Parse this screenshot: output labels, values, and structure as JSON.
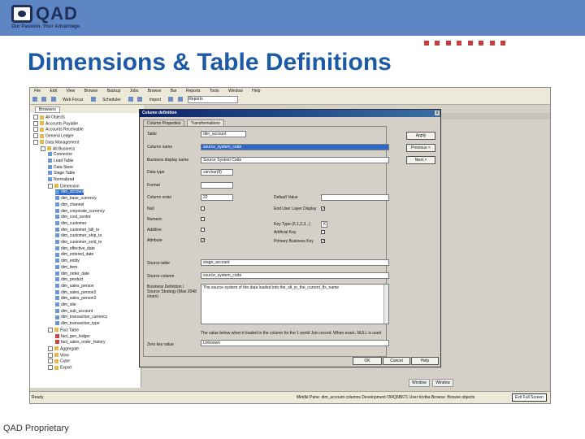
{
  "brand": {
    "name": "QAD",
    "tagline": "Our Passion. Your Advantage."
  },
  "slide_title": "Dimensions & Table Definitions",
  "footer": "QAD Proprietary",
  "app": {
    "menu": [
      "File",
      "Edit",
      "View",
      "Browse",
      "Backup",
      "Jobs",
      "Browse",
      "Bar",
      "Reports",
      "Tools",
      "Window",
      "Help"
    ],
    "toolbar": {
      "web_label": "Web Focus",
      "scheduler": "Scheduler",
      "import": "Import",
      "reports": "Reports"
    },
    "tab_label": "Browsers",
    "tree": [
      {
        "label": "All Objects",
        "indent": 0,
        "icon": "folder"
      },
      {
        "label": "Accounts Payable",
        "indent": 0,
        "icon": "folder"
      },
      {
        "label": "Accounts Receivable",
        "indent": 0,
        "icon": "folder"
      },
      {
        "label": "General Ledger",
        "indent": 0,
        "icon": "folder"
      },
      {
        "label": "Data Management",
        "indent": 0,
        "icon": "folder"
      },
      {
        "label": "All Business",
        "indent": 1,
        "icon": "folder"
      },
      {
        "label": "Connector",
        "indent": 2,
        "icon": "table"
      },
      {
        "label": "Load Table",
        "indent": 2,
        "icon": "table"
      },
      {
        "label": "Data Store",
        "indent": 2,
        "icon": "table"
      },
      {
        "label": "Stage Table",
        "indent": 2,
        "icon": "table"
      },
      {
        "label": "Normalized",
        "indent": 2,
        "icon": "table"
      },
      {
        "label": "Dimension",
        "indent": 2,
        "icon": "folder"
      },
      {
        "label": "dim_account",
        "indent": 3,
        "icon": "table",
        "selected": true
      },
      {
        "label": "dim_base_currency",
        "indent": 3,
        "icon": "table"
      },
      {
        "label": "dim_channel",
        "indent": 3,
        "icon": "table"
      },
      {
        "label": "dim_corporate_currency",
        "indent": 3,
        "icon": "table"
      },
      {
        "label": "dim_cost_centre",
        "indent": 3,
        "icon": "table"
      },
      {
        "label": "dim_customer",
        "indent": 3,
        "icon": "table"
      },
      {
        "label": "dim_customer_bill_to",
        "indent": 3,
        "icon": "table"
      },
      {
        "label": "dim_customer_ship_to",
        "indent": 3,
        "icon": "table"
      },
      {
        "label": "dim_customer_sold_to",
        "indent": 3,
        "icon": "table"
      },
      {
        "label": "dim_effective_date",
        "indent": 3,
        "icon": "table"
      },
      {
        "label": "dim_entered_date",
        "indent": 3,
        "icon": "table"
      },
      {
        "label": "dim_entity",
        "indent": 3,
        "icon": "table"
      },
      {
        "label": "dim_item",
        "indent": 3,
        "icon": "table"
      },
      {
        "label": "dim_order_date",
        "indent": 3,
        "icon": "table"
      },
      {
        "label": "dim_product",
        "indent": 3,
        "icon": "table"
      },
      {
        "label": "dim_sales_person",
        "indent": 3,
        "icon": "table"
      },
      {
        "label": "dim_sales_person2",
        "indent": 3,
        "icon": "table"
      },
      {
        "label": "dim_sales_person3",
        "indent": 3,
        "icon": "table"
      },
      {
        "label": "dim_site",
        "indent": 3,
        "icon": "table"
      },
      {
        "label": "dim_sub_account",
        "indent": 3,
        "icon": "table"
      },
      {
        "label": "dim_transaction_currency",
        "indent": 3,
        "icon": "table"
      },
      {
        "label": "dim_transaction_type",
        "indent": 3,
        "icon": "table"
      },
      {
        "label": "Fact Table",
        "indent": 2,
        "icon": "folder"
      },
      {
        "label": "fact_gen_ledger",
        "indent": 3,
        "icon": "tool"
      },
      {
        "label": "fact_sales_order_history",
        "indent": 3,
        "icon": "tool"
      },
      {
        "label": "Aggregate",
        "indent": 2,
        "icon": "folder"
      },
      {
        "label": "View",
        "indent": 2,
        "icon": "folder"
      },
      {
        "label": "Cube",
        "indent": 2,
        "icon": "folder"
      },
      {
        "label": "Export",
        "indent": 2,
        "icon": "folder"
      }
    ],
    "status": {
      "left": "Ready",
      "right": "Middle Pane: dim_account columns   Development Ol4Q6B671   User:Id:dba   Browse: Browse objects",
      "button": "Exit Full Screen"
    },
    "window_buttons": [
      "Window",
      "Window"
    ]
  },
  "dialog": {
    "title": "Column definition",
    "close": "x",
    "tabs": [
      "Column Properties",
      "Transformations"
    ],
    "fields": {
      "table_label": "Table",
      "table_value": "dim_account",
      "column_name_label": "Column name",
      "column_name_value": "source_system_code",
      "business_display_label": "Business display name",
      "business_display_value": "Source System Code",
      "data_type_label": "Data type",
      "data_type_value": "varchar(8)",
      "format_label": "Format",
      "column_order_label": "Column order",
      "column_order_value": "22",
      "default_value_label": "Default Value",
      "null_label": "Null",
      "end_user_label": "End User Layer Display",
      "numeric_label": "Numeric",
      "key_type_label": "Key Type (0,1,2,3...)",
      "key_type_value": "K",
      "additive_label": "Additive",
      "artificial_key_label": "Artificial Key",
      "attribute_label": "Attribute",
      "primary_business_key_label": "Primary Business Key",
      "source_table_label": "Source table",
      "source_table_value": "stage_account",
      "source_column_label": "Source column",
      "source_column_value": "source_system_code",
      "bus_def_label": "Business Definition / Source Strategy (Max 2048 chars)",
      "bus_def_text": "The source system of the data loaded into the_stl_in_the_current_fls_name",
      "info_text": "The value below when it loaded in the column for the 1 world Join record. When exact, NULL is used",
      "zero_key_label": "Zero key value",
      "zero_key_value": "Unknown"
    },
    "buttons": {
      "apply": "Apply",
      "prev": "Previous <",
      "next": "Next >",
      "ok": "OK",
      "cancel": "Cancel",
      "help": "Help"
    }
  }
}
